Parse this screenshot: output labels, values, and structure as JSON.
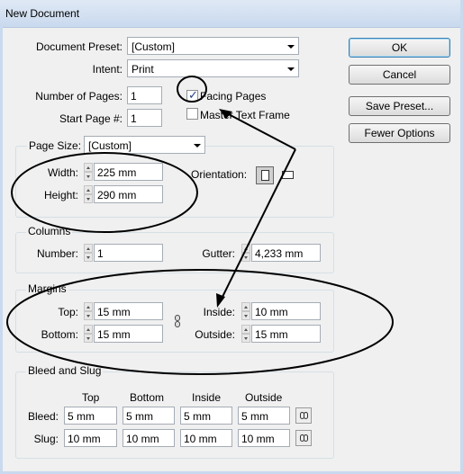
{
  "window": {
    "title": "New Document"
  },
  "preset": {
    "label": "Document Preset:",
    "value": "[Custom]"
  },
  "intent": {
    "label": "Intent:",
    "value": "Print"
  },
  "pages": {
    "number_label": "Number of Pages:",
    "number_value": "1",
    "start_label": "Start Page #:",
    "start_value": "1",
    "facing_label": "Facing Pages",
    "facing_checked": true,
    "master_label": "Master Text Frame",
    "master_checked": false
  },
  "buttons": {
    "ok": "OK",
    "cancel": "Cancel",
    "save_preset": "Save Preset...",
    "fewer": "Fewer Options"
  },
  "page_size": {
    "label": "Page Size:",
    "value": "[Custom]",
    "width_label": "Width:",
    "width_value": "225 mm",
    "height_label": "Height:",
    "height_value": "290 mm",
    "orientation_label": "Orientation:",
    "orientation_selected": "portrait"
  },
  "columns": {
    "title": "Columns",
    "number_label": "Number:",
    "number_value": "1",
    "gutter_label": "Gutter:",
    "gutter_value": "4,233 mm"
  },
  "margins": {
    "title": "Margins",
    "top_label": "Top:",
    "top_value": "15 mm",
    "bottom_label": "Bottom:",
    "bottom_value": "15 mm",
    "inside_label": "Inside:",
    "inside_value": "10 mm",
    "outside_label": "Outside:",
    "outside_value": "15 mm"
  },
  "bleed_slug": {
    "title": "Bleed and Slug",
    "headers": [
      "Top",
      "Bottom",
      "Inside",
      "Outside"
    ],
    "bleed_label": "Bleed:",
    "bleed_values": [
      "5 mm",
      "5 mm",
      "5 mm",
      "5 mm"
    ],
    "slug_label": "Slug:",
    "slug_values": [
      "10 mm",
      "10 mm",
      "10 mm",
      "10 mm"
    ]
  },
  "colors": {
    "annotation": "#000000",
    "title_bar": "#c9d9ee",
    "dialog_bg": "#f0f0f0"
  }
}
